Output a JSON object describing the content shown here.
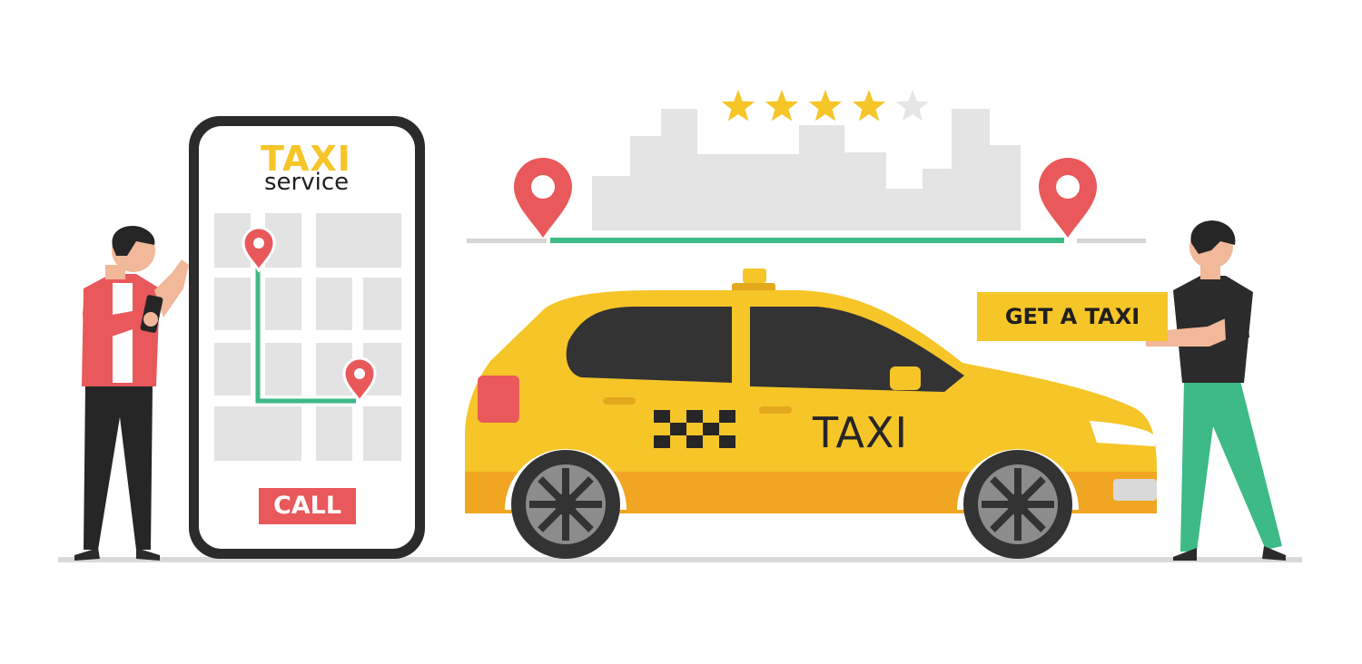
{
  "app": {
    "title": "TAXI",
    "subtitle": "service",
    "call_label": "CALL"
  },
  "sign": {
    "label": "GET A TAXI"
  },
  "car": {
    "label": "TAXI"
  },
  "rating": {
    "value": 4,
    "max": 5
  },
  "colors": {
    "accent_yellow": "#f6c528",
    "route_green": "#3dba86",
    "pin_red": "#e9585a",
    "city_gray": "#e2e2e2",
    "ink": "#262626"
  }
}
